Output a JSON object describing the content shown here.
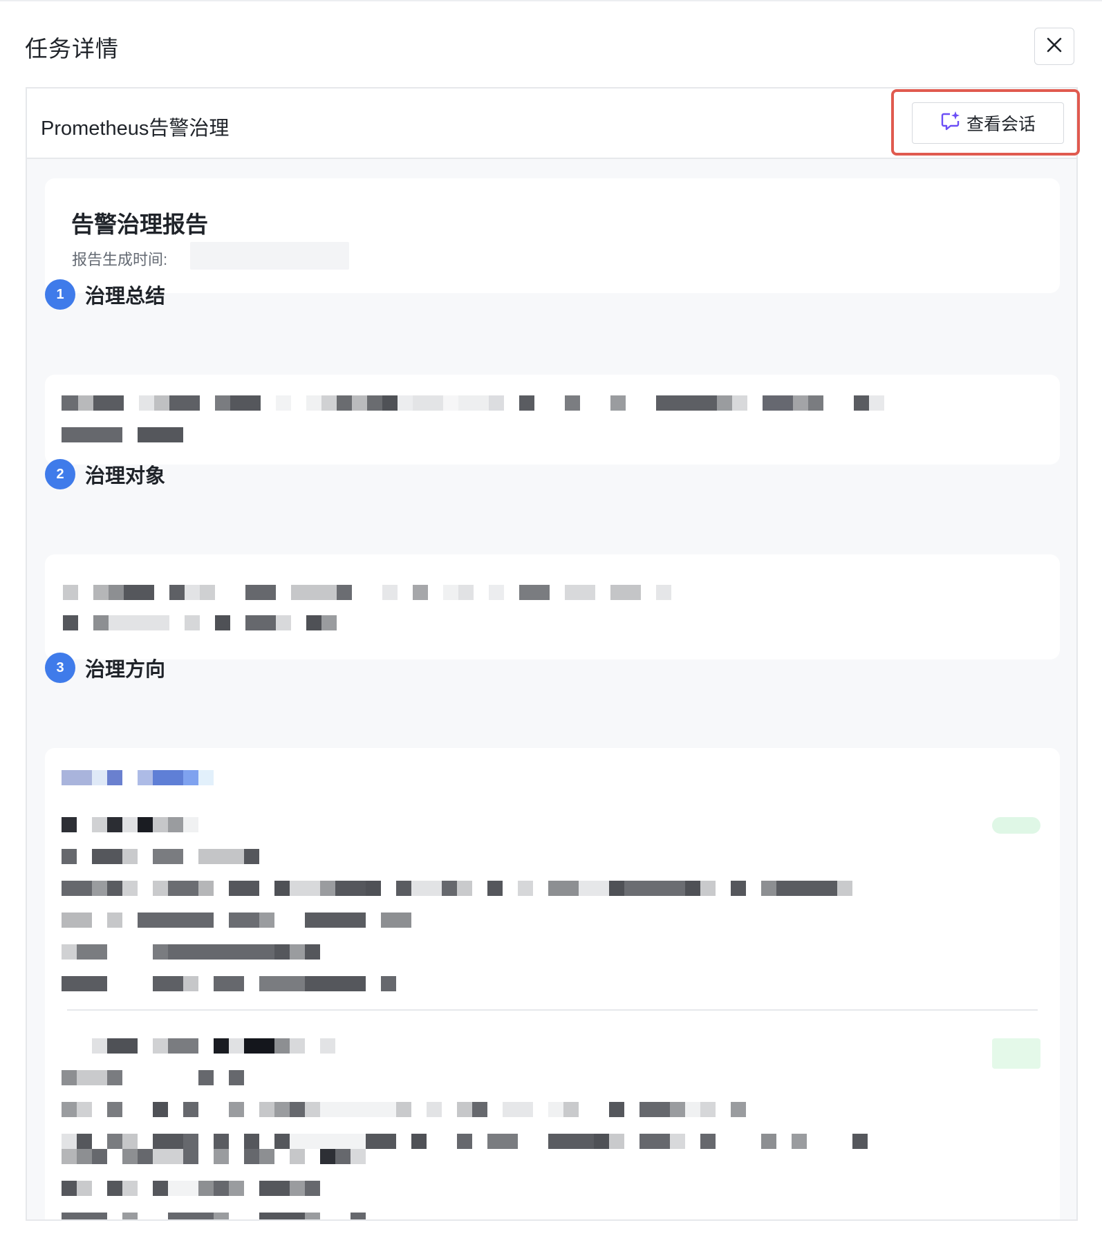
{
  "panel": {
    "title": "任务详情"
  },
  "task": {
    "name": "Prometheus告警治理",
    "view_chat_label": "查看会话"
  },
  "report": {
    "title": "告警治理报告",
    "time_label": "报告生成时间:"
  },
  "sections": [
    {
      "num": "1",
      "title": "治理总结"
    },
    {
      "num": "2",
      "title": "治理对象"
    },
    {
      "num": "3",
      "title": "治理方向"
    }
  ],
  "icons": {
    "close": "close-icon",
    "chat": "chat-sparkle-icon"
  },
  "colors": {
    "accent": "#3f7bea",
    "highlight": "#e05a4f",
    "icon": "#6b4ef6"
  }
}
